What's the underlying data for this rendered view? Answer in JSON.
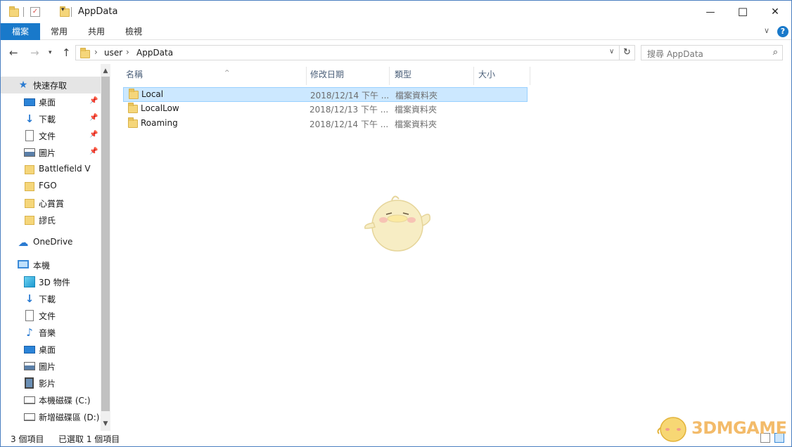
{
  "window": {
    "title": "AppData",
    "minimize_glyph": "—",
    "maximize_glyph": "☐",
    "close_glyph": "✕"
  },
  "ribbon": {
    "tabs": [
      {
        "label": "檔案",
        "active": true
      },
      {
        "label": "常用",
        "active": false
      },
      {
        "label": "共用",
        "active": false
      },
      {
        "label": "檢視",
        "active": false
      }
    ],
    "help_label": "?"
  },
  "address": {
    "crumbs": [
      "user",
      "AppData"
    ],
    "search_placeholder": "搜尋 AppData"
  },
  "nav": {
    "quick_access_label": "快速存取",
    "quick_items": [
      {
        "label": "桌面",
        "icon": "desktop-icon",
        "pinned": true
      },
      {
        "label": "下載",
        "icon": "download-icon",
        "pinned": true
      },
      {
        "label": "文件",
        "icon": "document-icon",
        "pinned": true
      },
      {
        "label": "圖片",
        "icon": "pictures-icon",
        "pinned": true
      },
      {
        "label": "Battlefield V",
        "icon": "folder-icon",
        "pinned": false
      },
      {
        "label": "FGO",
        "icon": "folder-icon",
        "pinned": false
      },
      {
        "label": "心賞賞",
        "icon": "folder-icon",
        "pinned": false
      },
      {
        "label": "謬氏",
        "icon": "folder-icon",
        "pinned": false
      }
    ],
    "onedrive_label": "OneDrive",
    "this_pc_label": "本機",
    "pc_items": [
      {
        "label": "3D 物件",
        "icon": "3d-objects-icon"
      },
      {
        "label": "下載",
        "icon": "download-icon"
      },
      {
        "label": "文件",
        "icon": "document-icon"
      },
      {
        "label": "音樂",
        "icon": "music-icon"
      },
      {
        "label": "桌面",
        "icon": "desktop-icon"
      },
      {
        "label": "圖片",
        "icon": "pictures-icon"
      },
      {
        "label": "影片",
        "icon": "video-icon"
      },
      {
        "label": "本機磁碟 (C:)",
        "icon": "drive-icon"
      },
      {
        "label": "新增磁碟區 (D:)",
        "icon": "drive-icon"
      }
    ]
  },
  "list": {
    "columns": [
      "名稱",
      "修改日期",
      "類型",
      "大小"
    ],
    "rows": [
      {
        "name": "Local",
        "date": "2018/12/14 下午 ...",
        "type": "檔案資料夾",
        "selected": true
      },
      {
        "name": "LocalLow",
        "date": "2018/12/13 下午 ...",
        "type": "檔案資料夾",
        "selected": false
      },
      {
        "name": "Roaming",
        "date": "2018/12/14 下午 ...",
        "type": "檔案資料夾",
        "selected": false
      }
    ]
  },
  "status": {
    "item_count": "3 個項目",
    "selected_count": "已選取 1 個項目"
  },
  "watermark": {
    "text": "3DMGAME"
  },
  "colors": {
    "accent": "#1979ca",
    "selection": "#cce8ff",
    "folder": "#f5d67a"
  }
}
